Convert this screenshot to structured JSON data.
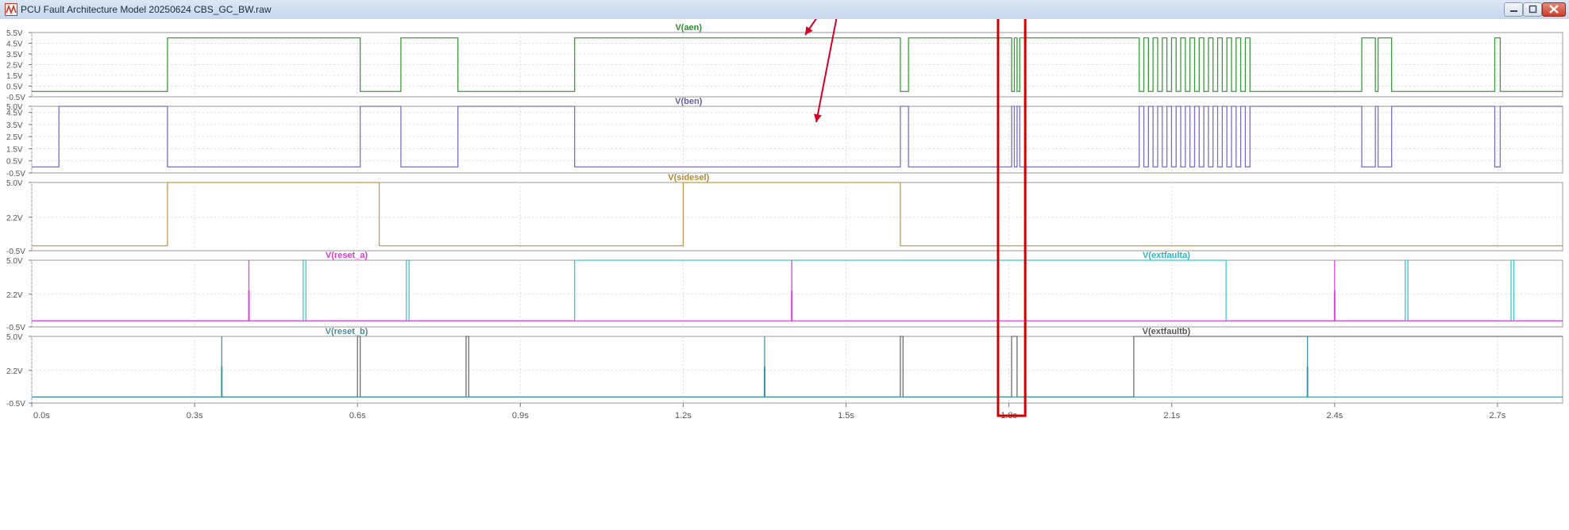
{
  "window": {
    "title": "PCU Fault Architecture Model 20250624 CBS_GC_BW.raw",
    "icon": "ltspice-waveform-icon",
    "controls": [
      "minimize-icon",
      "maximize-icon",
      "close-icon"
    ]
  },
  "chart_data": {
    "type": "line",
    "x_ticks": [
      "0.0s",
      "0.3s",
      "0.6s",
      "0.9s",
      "1.2s",
      "1.5s",
      "1.8s",
      "2.1s",
      "2.4s",
      "2.7s"
    ],
    "x_tick_values": [
      0.0,
      0.3,
      0.6,
      0.9,
      1.2,
      1.5,
      1.8,
      2.1,
      2.4,
      2.7
    ],
    "xlim": [
      0.0,
      2.82
    ],
    "grid": true,
    "highlight": {
      "x_range": [
        1.78,
        1.83
      ],
      "color": "#cc0000"
    },
    "annotation_arrows": {
      "color": "#d40026",
      "count": 2
    },
    "panes": [
      {
        "ylim": [
          -0.5,
          5.5
        ],
        "y_ticks": [
          "5.5V",
          "4.5V",
          "3.5V",
          "2.5V",
          "1.5V",
          "0.5V",
          "-0.5V"
        ],
        "y_tick_values": [
          5.5,
          4.5,
          3.5,
          2.5,
          1.5,
          0.5,
          -0.5
        ],
        "labels": [
          {
            "text": "V(aen)",
            "color": "#2e8b2e",
            "x": 1.21
          }
        ],
        "series": [
          {
            "name": "V(aen)",
            "color": "#3c9a3c",
            "low": 0.0,
            "high": 5.0,
            "initial": "low",
            "edges": [
              0.25,
              0.605,
              0.68,
              0.785,
              1.0,
              1.6,
              1.615,
              1.805,
              1.81,
              1.815,
              1.82
            ],
            "burst": [
              2.04,
              2.245,
              0.0085
            ],
            "edges2": [
              2.45,
              2.475,
              2.48,
              2.505,
              2.695,
              2.705
            ]
          }
        ]
      },
      {
        "ylim": [
          -0.5,
          5.0
        ],
        "y_ticks": [
          "5.0V",
          "4.5V",
          "3.5V",
          "2.5V",
          "1.5V",
          "0.5V",
          "-0.5V"
        ],
        "y_tick_values": [
          5.0,
          4.5,
          3.5,
          2.5,
          1.5,
          0.5,
          -0.5
        ],
        "labels": [
          {
            "text": "V(ben)",
            "color": "#6a5aa8",
            "x": 1.21
          }
        ],
        "series": [
          {
            "name": "V(ben)",
            "color": "#7b6fc2",
            "low": 0.0,
            "high": 5.0,
            "initial": "low",
            "edges": [
              0.05,
              0.25,
              0.605,
              0.68,
              0.785,
              1.0,
              1.6,
              1.615,
              1.805,
              1.81,
              1.815,
              1.82
            ],
            "burst": [
              2.04,
              2.245,
              0.0085
            ],
            "edges2": [
              2.45,
              2.475,
              2.48,
              2.505,
              2.695,
              2.705
            ]
          }
        ]
      },
      {
        "ylim": [
          -0.5,
          5.0
        ],
        "y_ticks": [
          "5.0V",
          "2.2V",
          "-0.5V"
        ],
        "y_tick_values": [
          5.0,
          2.2,
          -0.5
        ],
        "labels": [
          {
            "text": "V(sidesel)",
            "color": "#b8862c",
            "x": 1.21
          }
        ],
        "series": [
          {
            "name": "V(sidesel)",
            "color": "#c49a50",
            "low": -0.1,
            "high": 5.0,
            "initial": "low",
            "edges": [
              0.25,
              0.64,
              1.2,
              1.6
            ]
          }
        ]
      },
      {
        "ylim": [
          -0.5,
          5.0
        ],
        "y_ticks": [
          "5.0V",
          "2.2V",
          "-0.5V"
        ],
        "y_tick_values": [
          5.0,
          2.2,
          -0.5
        ],
        "labels": [
          {
            "text": "V(reset_a)",
            "color": "#d63ad6",
            "x": 0.58
          },
          {
            "text": "V(extfaulta)",
            "color": "#22b8c4",
            "x": 2.09
          }
        ],
        "series": [
          {
            "name": "V(extfaulta)",
            "color": "#3cc8d0",
            "low": 0.0,
            "high": 5.0,
            "initial": "low",
            "edges": [
              0.5,
              0.505,
              0.69,
              0.695,
              1.0,
              2.2,
              2.53,
              2.535,
              2.725,
              2.73
            ]
          },
          {
            "name": "V(reset_a)",
            "color": "#e040e0",
            "low": 0.0,
            "high": 5.0,
            "initial": "low",
            "spikes": [
              0.4,
              1.4,
              2.4
            ]
          }
        ]
      },
      {
        "ylim": [
          -0.5,
          5.0
        ],
        "y_ticks": [
          "5.0V",
          "2.2V",
          "-0.5V"
        ],
        "y_tick_values": [
          5.0,
          2.2,
          -0.5
        ],
        "labels": [
          {
            "text": "V(reset_b)",
            "color": "#4a8a96",
            "x": 0.58
          },
          {
            "text": "V(extfaultb)",
            "color": "#555555",
            "x": 2.09
          }
        ],
        "series": [
          {
            "name": "V(extfaultb)",
            "color": "#6f6f6f",
            "low": 0.0,
            "high": 5.0,
            "initial": "low",
            "edges": [
              0.6,
              0.605,
              0.8,
              0.805,
              1.6,
              1.605,
              1.805,
              1.815,
              2.03
            ]
          },
          {
            "name": "V(reset_b)",
            "color": "#3a96a8",
            "low": 0.0,
            "high": 5.0,
            "initial": "low",
            "spikes": [
              0.35,
              1.35,
              2.35
            ]
          }
        ]
      }
    ]
  }
}
